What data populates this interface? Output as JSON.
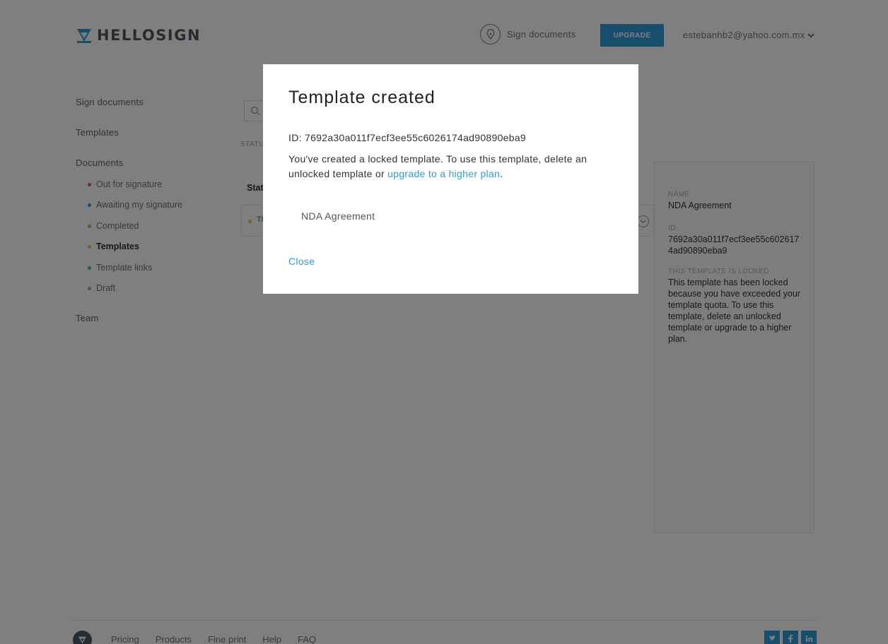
{
  "header": {
    "brand": "HELLOSIGN",
    "sign_documents": "Sign documents",
    "upgrade": "UPGRADE",
    "account_email": "estebanhb2@yahoo.com.mx"
  },
  "sidebar": {
    "sign_documents": "Sign documents",
    "templates": "Templates",
    "documents": "Documents",
    "items": [
      {
        "label": "Out for signature",
        "color": "#e0524f"
      },
      {
        "label": "Awaiting my signature",
        "color": "#2d9dd9"
      },
      {
        "label": "Completed",
        "color": "#8bc34a"
      },
      {
        "label": "Templates",
        "color": "#f4c430"
      },
      {
        "label": "Template links",
        "color": "#3fbfa0"
      },
      {
        "label": "Draft",
        "color": "#9aa3aa"
      }
    ],
    "team": "Team"
  },
  "main": {
    "status_label": "STATU",
    "table_header": "Stat",
    "row_label": "Th"
  },
  "detail": {
    "name_label": "NAME",
    "name_value": "NDA Agreement",
    "id_label": "ID",
    "id_value": "7692a30a011f7ecf3ee55c6026174ad90890eba9",
    "locked_label": "THIS TEMPLATE IS LOCKED",
    "locked_text": "This template has been locked because you have exceeded your template quota. To use this template, delete an unlocked template or upgrade to a higher plan."
  },
  "modal": {
    "title": "Template created",
    "id_line": "ID: 7692a30a011f7ecf3ee55c6026174ad90890eba9",
    "message_before": "You've created a locked template. To use this template, delete an unlocked template or ",
    "message_link": "upgrade to a higher plan",
    "message_after": ".",
    "document_name": "NDA Agreement",
    "close": "Close"
  },
  "footer": {
    "links": [
      "Pricing",
      "Products",
      "Fine print",
      "Help",
      "FAQ"
    ],
    "social": [
      "twitter-icon",
      "facebook-icon",
      "linkedin-icon"
    ]
  },
  "colors": {
    "accent": "#2d9dd9",
    "overlay": "rgba(0,0,0,0.5)"
  }
}
